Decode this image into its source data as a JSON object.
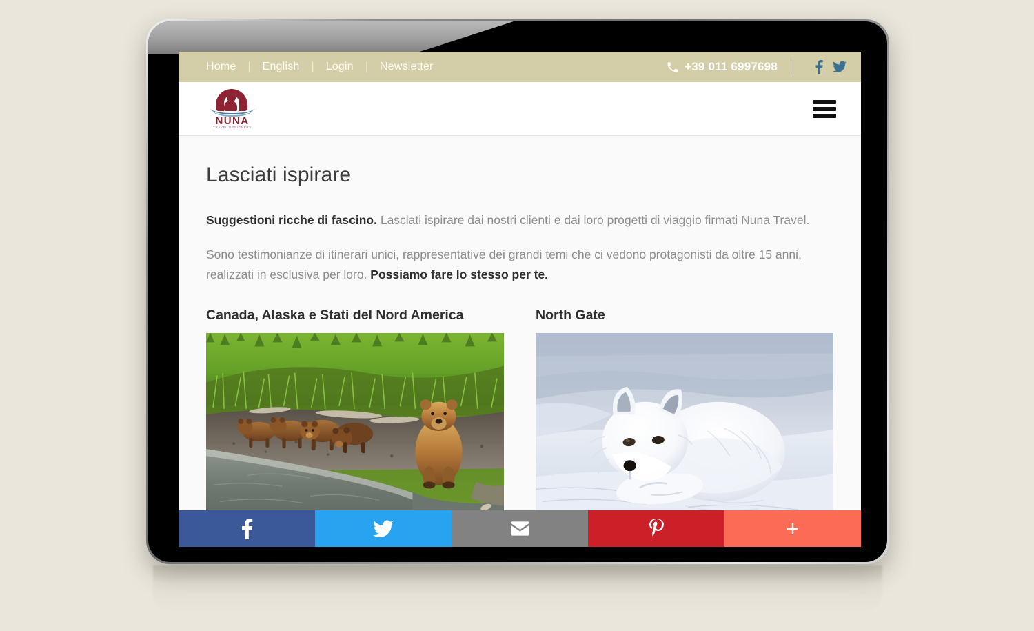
{
  "device": {
    "type": "tablet"
  },
  "topbar": {
    "nav": [
      {
        "label": "Home"
      },
      {
        "label": "English"
      },
      {
        "label": "Login"
      },
      {
        "label": "Newsletter"
      }
    ],
    "separator": "|",
    "phone": "+39 011 6997698",
    "phone_icon": "phone-icon",
    "social": [
      {
        "name": "facebook-icon",
        "label": "f"
      },
      {
        "name": "twitter-icon",
        "label": "t"
      }
    ],
    "bg_color": "#d3cea7",
    "text_color": "#ffffff",
    "social_color": "#3d6f93"
  },
  "header": {
    "logo": {
      "name": "NUNA",
      "tagline": "TRAVEL DESIGNERS",
      "brand_color": "#8e2334",
      "wave_color": "#4b7fa6"
    },
    "menu_icon": "hamburger-menu-icon"
  },
  "main": {
    "page_title": "Lasciati ispirare",
    "paragraphs": [
      {
        "bold_prefix": "Suggestioni ricche di fascino.",
        "text": " Lasciati ispirare dai nostri clienti e dai loro progetti di viaggio firmati Nuna Travel."
      },
      {
        "text": "Sono testimonianze di itinerari unici, rappresentative dei grandi temi che ci vedono protagonisti da oltre 15 anni, realizzati in esclusiva per loro. ",
        "bold_suffix": "Possiamo fare lo stesso per te."
      }
    ],
    "cards": [
      {
        "title": "Canada, Alaska e Stati del Nord America",
        "image_alt": "grizzly bear family walking along a river bank with green grass"
      },
      {
        "title": "North Gate",
        "image_alt": "arctic fox curled up sleeping in the snow"
      }
    ]
  },
  "sharebar": {
    "buttons": [
      {
        "name": "share-facebook-button",
        "label": "f",
        "color": "#3b5998"
      },
      {
        "name": "share-twitter-button",
        "label": "t",
        "color": "#27a3ef"
      },
      {
        "name": "share-email-button",
        "label": "email",
        "color": "#828282"
      },
      {
        "name": "share-pinterest-button",
        "label": "P",
        "color": "#cb2027"
      },
      {
        "name": "share-more-button",
        "label": "+",
        "color": "#fb6b56"
      }
    ]
  },
  "colors": {
    "page_background": "#eae6dc",
    "content_background": "#fafafa",
    "heading": "#3b3b3b",
    "body_text": "#8d8d8d",
    "bold_text": "#2e2e2e"
  }
}
